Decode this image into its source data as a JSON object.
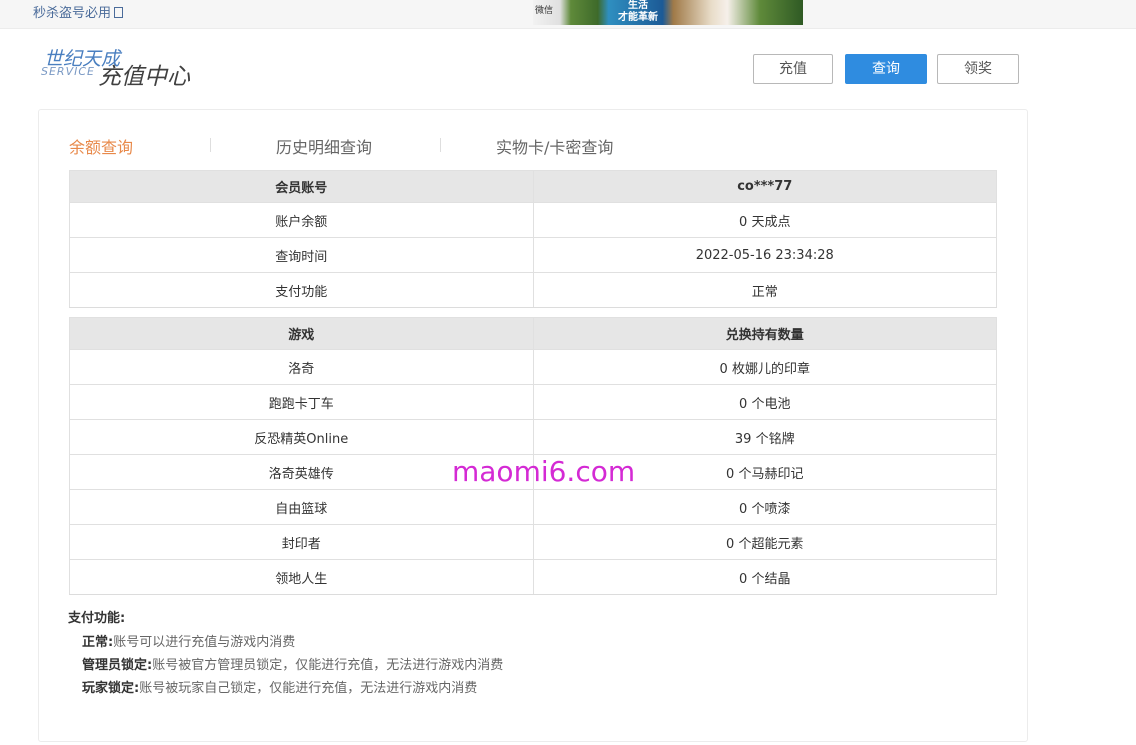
{
  "topbar": {
    "link_text": "秒杀盗号必用",
    "banner_text_line1": "生活",
    "banner_text_line2": "才能革新",
    "banner_icon_text": "微信"
  },
  "logo": {
    "name_cn": "世纪天成",
    "name_en": "SERVICE",
    "title_cn": "充值中心"
  },
  "header_buttons": {
    "recharge": "充值",
    "query": "查询",
    "claim": "领奖"
  },
  "tabs": [
    {
      "label": "余额查询",
      "active": true
    },
    {
      "label": "历史明细查询",
      "active": false
    },
    {
      "label": "实物卡/卡密查询",
      "active": false
    }
  ],
  "account_table": {
    "header_label": "会员账号",
    "header_value": "co***77",
    "rows": [
      {
        "label": "账户余额",
        "value": "0 天成点"
      },
      {
        "label": "查询时间",
        "value": "2022-05-16 23:34:28"
      },
      {
        "label": "支付功能",
        "value": "正常"
      }
    ]
  },
  "games_table": {
    "col_game": "游戏",
    "col_quantity": "兑换持有数量",
    "rows": [
      {
        "game": "洛奇",
        "quantity": "0 枚娜儿的印章"
      },
      {
        "game": "跑跑卡丁车",
        "quantity": "0 个电池"
      },
      {
        "game": "反恐精英Online",
        "quantity": "39 个铭牌"
      },
      {
        "game": "洛奇英雄传",
        "quantity": "0 个马赫印记"
      },
      {
        "game": "自由篮球",
        "quantity": "0 个喷漆"
      },
      {
        "game": "封印者",
        "quantity": "0 个超能元素"
      },
      {
        "game": "领地人生",
        "quantity": "0 个结晶"
      }
    ]
  },
  "watermark": "maomi6.com",
  "notes": {
    "title": "支付功能:",
    "items": [
      {
        "key": "正常:",
        "text": "账号可以进行充值与游戏内消费"
      },
      {
        "key": "管理员锁定:",
        "text": "账号被官方管理员锁定，仅能进行充值，无法进行游戏内消费"
      },
      {
        "key": "玩家锁定:",
        "text": "账号被玩家自己锁定，仅能进行充值，无法进行游戏内消费"
      }
    ]
  },
  "colors": {
    "accent_blue": "#2f8ce0",
    "tab_active": "#e8894a",
    "watermark": "#d42ad4",
    "table_header_bg": "#e6e6e6"
  }
}
